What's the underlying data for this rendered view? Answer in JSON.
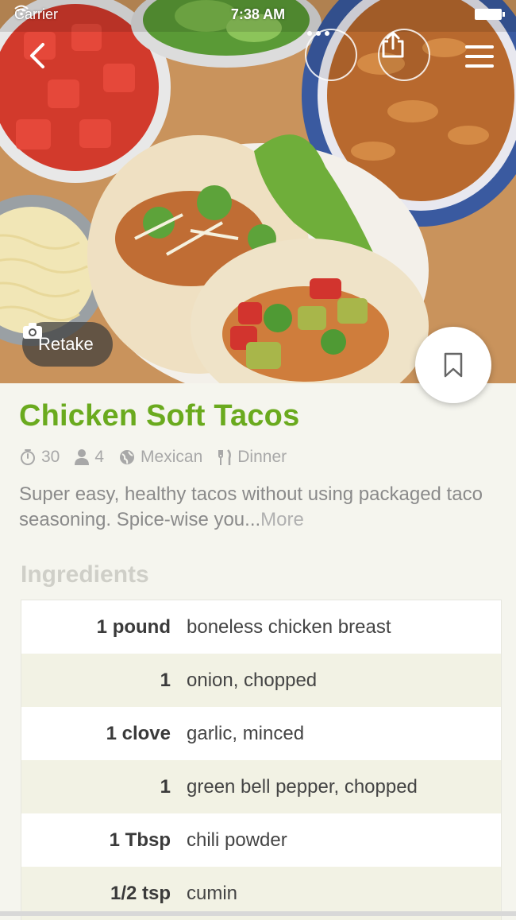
{
  "status_bar": {
    "carrier": "Carrier",
    "time": "7:38 AM"
  },
  "hero": {
    "retake_label": "Retake",
    "icons": [
      "back-arrow-icon",
      "more-icon",
      "share-icon",
      "menu-icon",
      "camera-icon",
      "bookmark-icon"
    ]
  },
  "recipe": {
    "title": "Chicken Soft Tacos",
    "meta": {
      "time": "30",
      "servings": "4",
      "cuisine": "Mexican",
      "course": "Dinner"
    },
    "description": "Super easy, healthy tacos without using packaged taco seasoning. Spice-wise you...",
    "more_label": "More"
  },
  "ingredients": {
    "heading": "Ingredients",
    "items": [
      {
        "qty": "1 pound",
        "name": "boneless chicken breast"
      },
      {
        "qty": "1",
        "name": "onion, chopped"
      },
      {
        "qty": "1 clove",
        "name": "garlic, minced"
      },
      {
        "qty": "1",
        "name": "green bell pepper, chopped"
      },
      {
        "qty": "1 Tbsp",
        "name": "chili powder"
      },
      {
        "qty": "1/2 tsp",
        "name": "cumin"
      }
    ]
  },
  "colors": {
    "title_green": "#6aaa1e",
    "background": "#f5f5ee",
    "row_alt": "#f2f2e4"
  }
}
